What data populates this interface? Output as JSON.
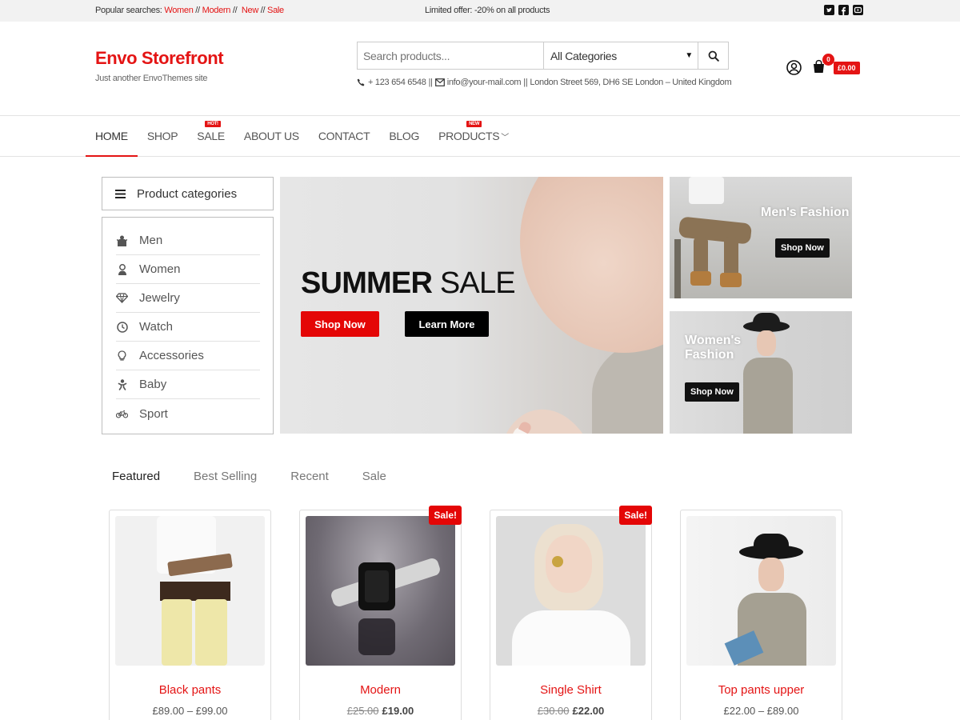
{
  "topbar": {
    "popular_label": "Popular searches:",
    "popular_links": [
      "Women",
      "Modern",
      "New",
      "Sale"
    ],
    "sep": "//",
    "offer": "Limited offer: -20% on all products",
    "social": [
      "twitter-icon",
      "facebook-icon",
      "youtube-icon"
    ]
  },
  "brand": {
    "title": "Envo Storefront",
    "tagline": "Just another EnvoThemes site"
  },
  "search": {
    "placeholder": "Search products...",
    "category": "All Categories"
  },
  "contact": {
    "phone": "+ 123 654 6548",
    "email": "info@your-mail.com",
    "address": "London Street 569, DH6 SE London – United Kingdom",
    "sep": "||"
  },
  "cart": {
    "count": "0",
    "amount": "£0.00"
  },
  "nav": {
    "items": [
      {
        "label": "HOME"
      },
      {
        "label": "SHOP"
      },
      {
        "label": "SALE",
        "badge": "HOT!"
      },
      {
        "label": "ABOUT US"
      },
      {
        "label": "CONTACT"
      },
      {
        "label": "BLOG"
      },
      {
        "label": "PRODUCTS",
        "badge": "NEW"
      }
    ]
  },
  "categories": {
    "heading": "Product categories",
    "items": [
      {
        "label": "Men",
        "icon": "men-icon"
      },
      {
        "label": "Women",
        "icon": "women-icon"
      },
      {
        "label": "Jewelry",
        "icon": "diamond-icon"
      },
      {
        "label": "Watch",
        "icon": "clock-icon"
      },
      {
        "label": "Accessories",
        "icon": "lightbulb-icon"
      },
      {
        "label": "Baby",
        "icon": "baby-icon"
      },
      {
        "label": "Sport",
        "icon": "bicycle-icon"
      }
    ]
  },
  "hero": {
    "title_bold": "SUMMER",
    "title_light": "SALE",
    "btn_primary": "Shop Now",
    "btn_secondary": "Learn More"
  },
  "banners": {
    "men": {
      "label": "Men's Fashion",
      "button": "Shop Now"
    },
    "women": {
      "label_line1": "Women's",
      "label_line2": "Fashion",
      "button": "Shop Now"
    }
  },
  "tabs": [
    "Featured",
    "Best Selling",
    "Recent",
    "Sale"
  ],
  "products": [
    {
      "name": "Black pants",
      "price": "£89.00 – £99.00"
    },
    {
      "name": "Modern",
      "sale": "Sale!",
      "old_price": "£25.00",
      "price": "£19.00"
    },
    {
      "name": "Single Shirt",
      "sale": "Sale!",
      "old_price": "£30.00",
      "price": "£22.00"
    },
    {
      "name": "Top pants upper",
      "price": "£22.00 – £89.00"
    }
  ],
  "colors": {
    "accent": "#e41414",
    "dark": "#111111"
  }
}
